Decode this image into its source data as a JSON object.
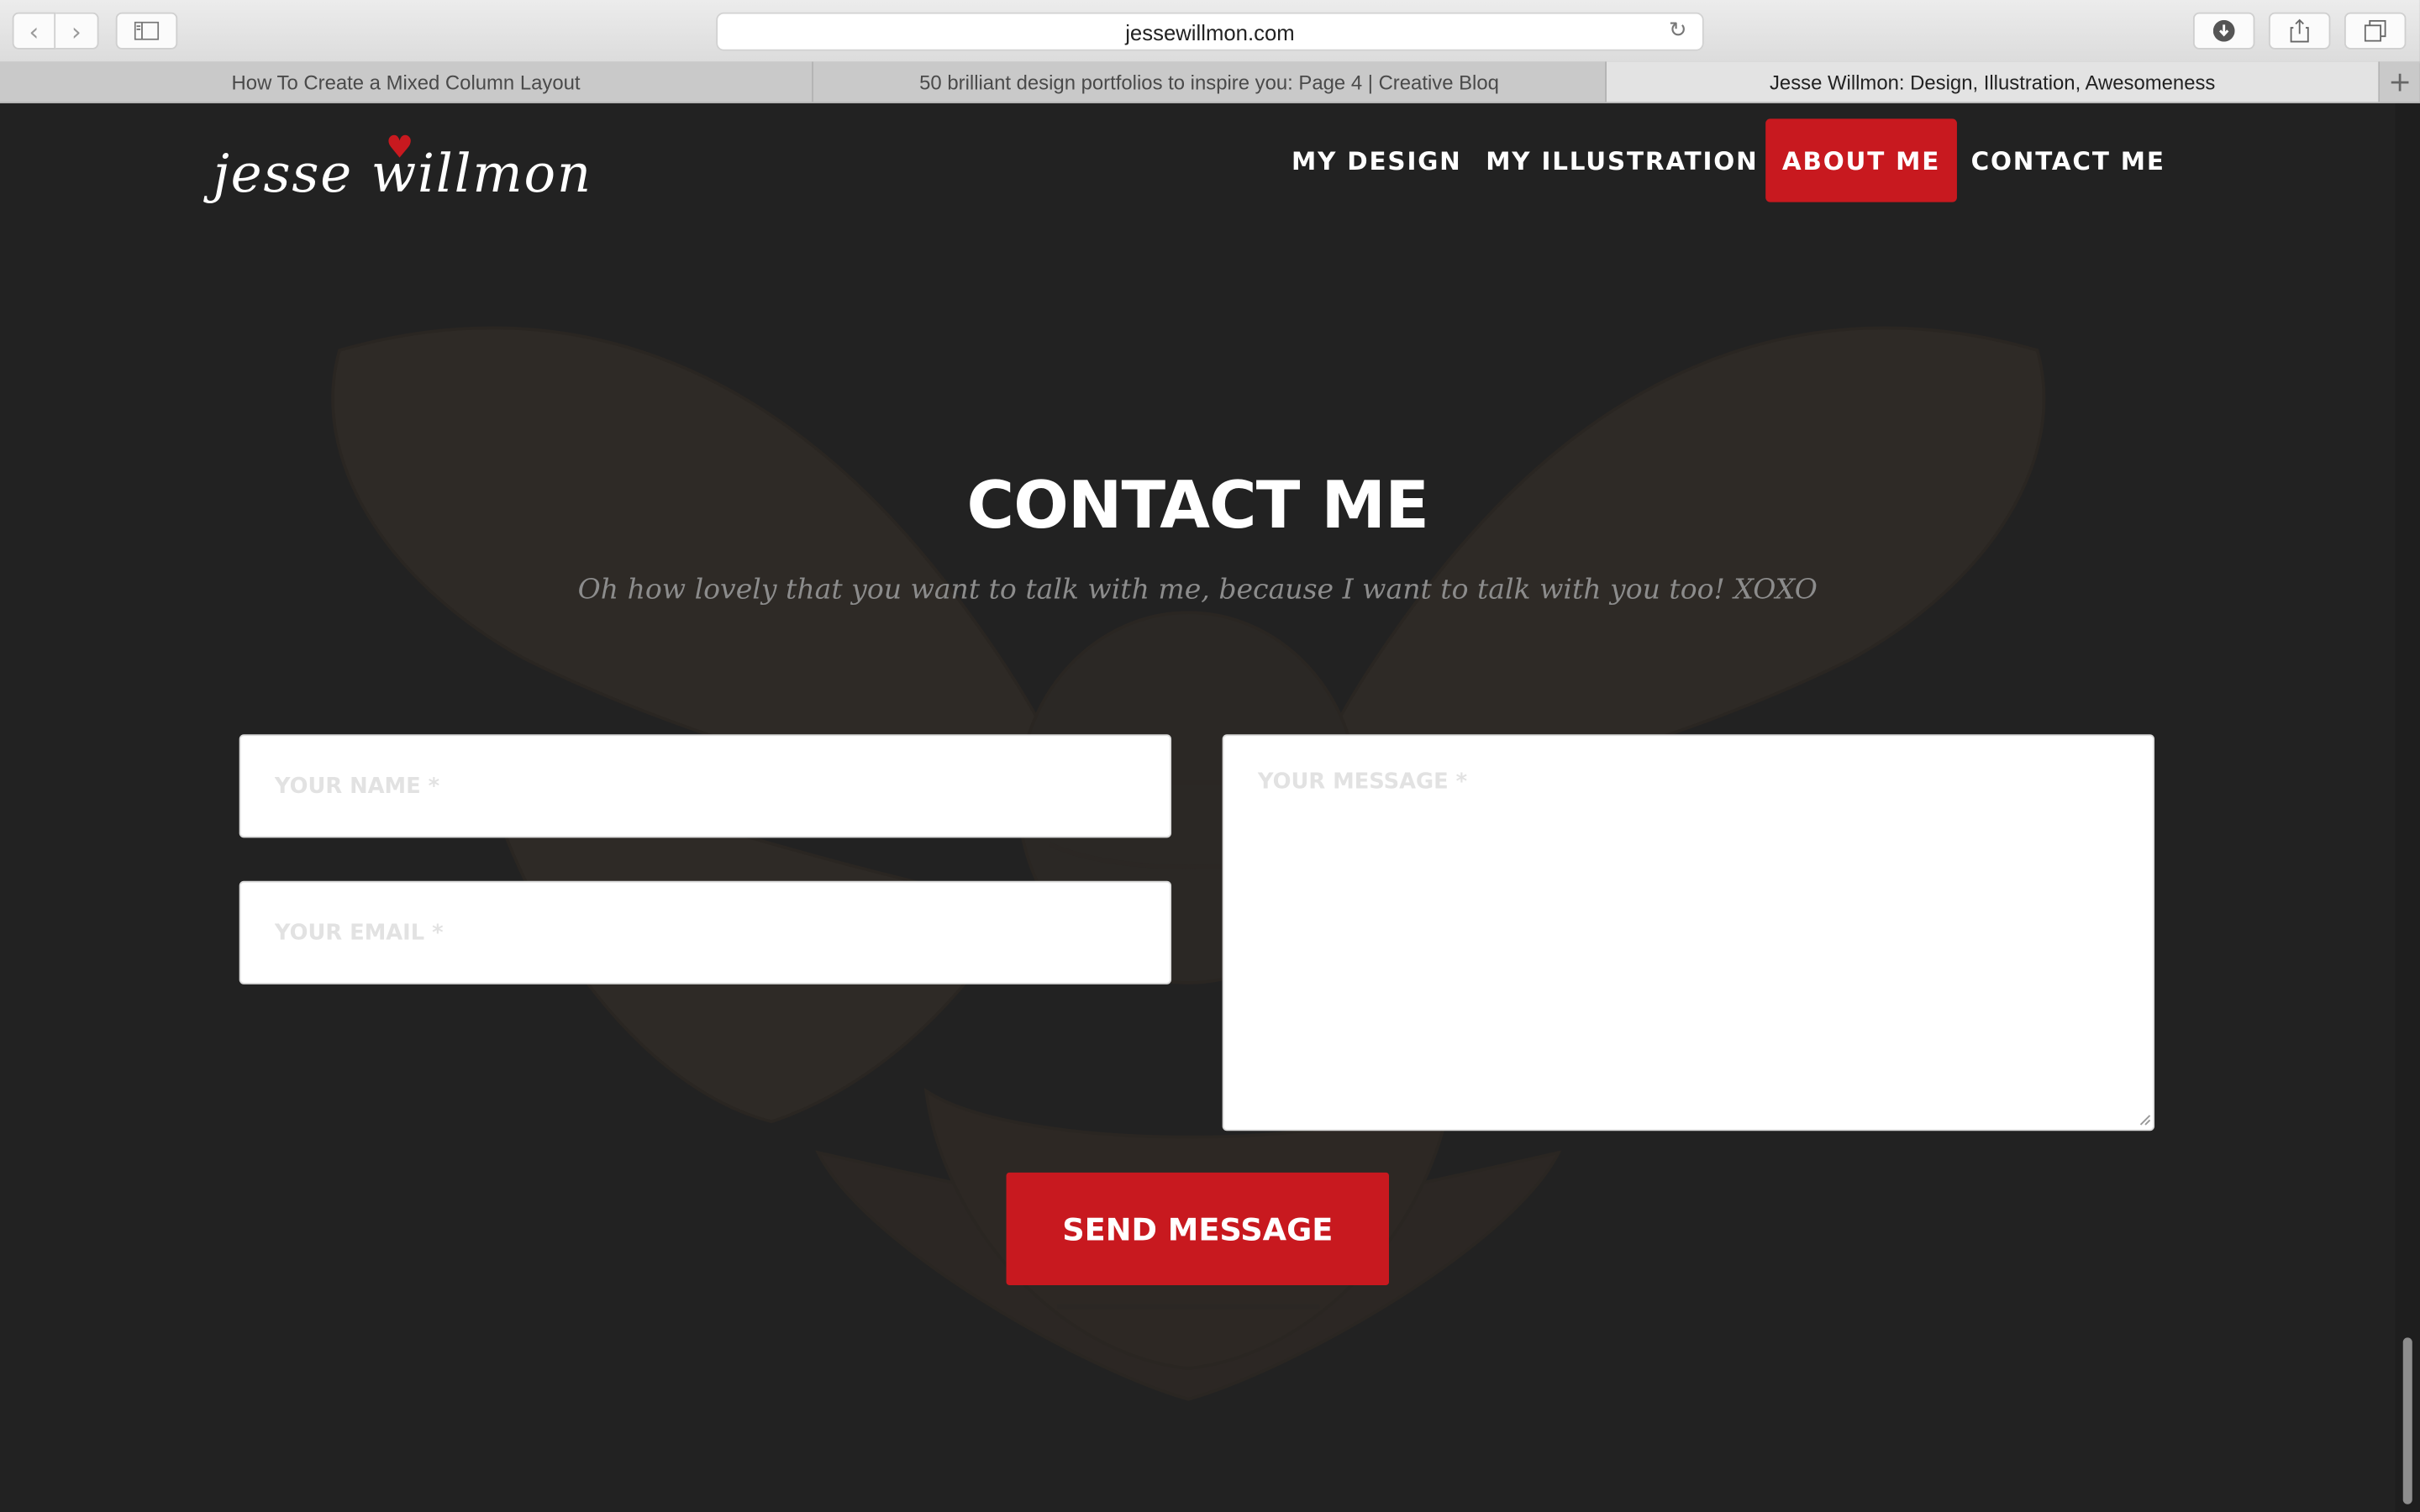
{
  "browser": {
    "url": "jessewillmon.com",
    "tabs": [
      {
        "title": "How To Create a Mixed Column Layout"
      },
      {
        "title": "50 brilliant design portfolios to inspire you: Page 4 | Creative Bloq"
      },
      {
        "title": "Jesse Willmon: Design, Illustration, Awesomeness"
      }
    ],
    "icons": {
      "back": "chevron-left-icon",
      "forward": "chevron-right-icon",
      "sidebar": "sidebar-icon",
      "reload": "reload-icon",
      "download": "download-icon",
      "share": "share-icon",
      "tabs": "tabs-icon",
      "new_tab": "plus-icon"
    }
  },
  "site": {
    "logo_text": "jesse willmon",
    "nav": {
      "design": "MY DESIGN",
      "illustration": "MY ILLUSTRATION",
      "about": "ABOUT ME",
      "contact": "CONTACT ME"
    }
  },
  "contact": {
    "title": "CONTACT ME",
    "subtitle": "Oh how lovely that you want to talk with me, because I want to talk with you too! XOXO",
    "name_placeholder": "YOUR NAME *",
    "email_placeholder": "YOUR EMAIL *",
    "message_placeholder": "YOUR MESSAGE *",
    "send_label": "SEND MESSAGE"
  },
  "colors": {
    "accent": "#c8191f",
    "background": "#222222",
    "subtitle": "#8c8c8c"
  }
}
